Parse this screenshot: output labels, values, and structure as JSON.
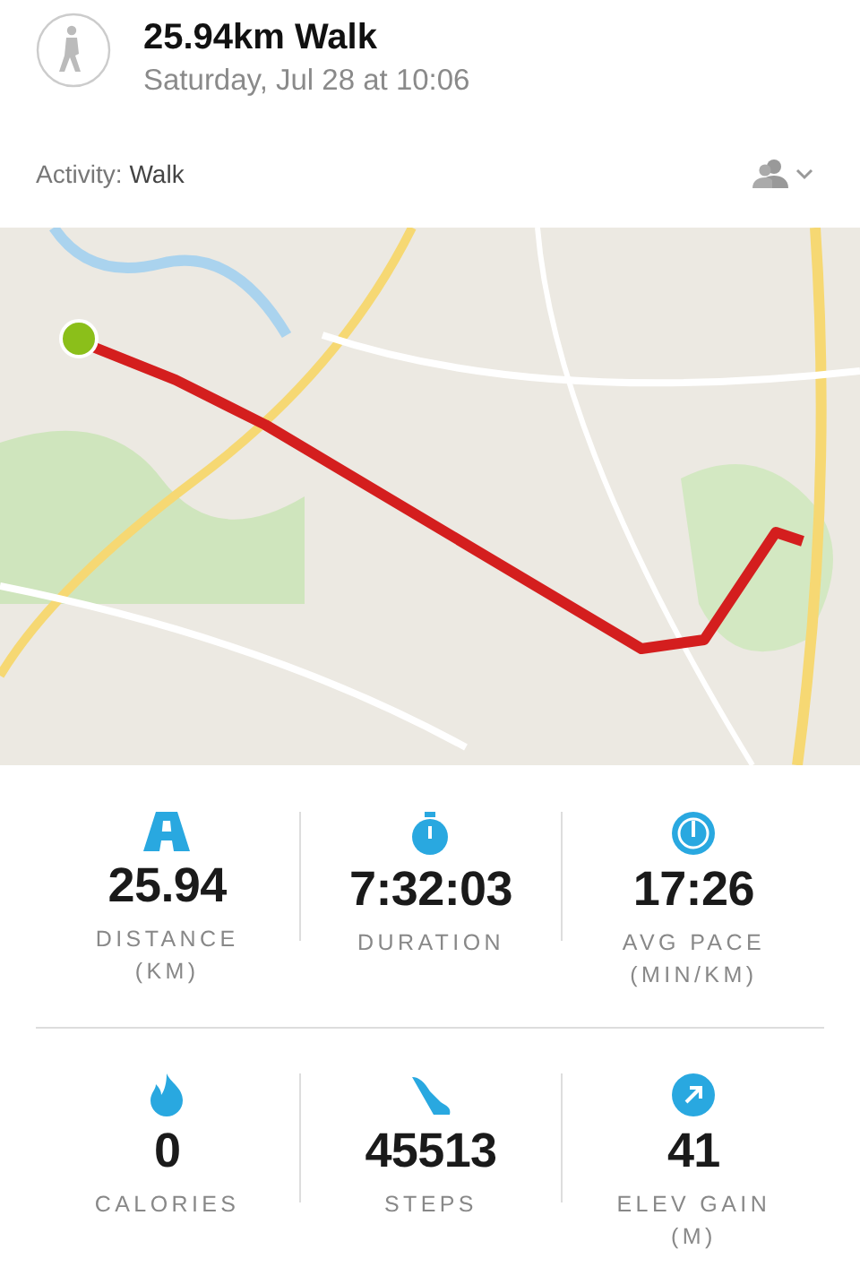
{
  "header": {
    "title": "25.94km Walk",
    "subtitle": "Saturday, Jul 28 at 10:06"
  },
  "activity": {
    "label": "Activity:",
    "value": "Walk"
  },
  "stats": [
    {
      "kind": "distance",
      "value": "25.94",
      "label": "DISTANCE",
      "unit": "(KM)"
    },
    {
      "kind": "duration",
      "value": "7:32:03",
      "label": "DURATION"
    },
    {
      "kind": "pace",
      "value": "17:26",
      "label": "AVG PACE",
      "unit": "(MIN/KM)"
    },
    {
      "kind": "calories",
      "value": "0",
      "label": "CALORIES"
    },
    {
      "kind": "steps",
      "value": "45513",
      "label": "STEPS"
    },
    {
      "kind": "elevation",
      "value": "41",
      "label": "ELEV GAIN",
      "unit": "(M)"
    }
  ]
}
